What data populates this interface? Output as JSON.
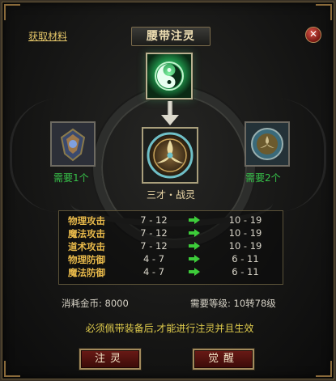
{
  "window": {
    "title": "腰带注灵",
    "get_material_link": "获取材料",
    "close_icon": "close-icon",
    "close_glyph": "✕"
  },
  "slots": {
    "top": {
      "icon": "yin-yang-orb-icon"
    },
    "left": {
      "icon": "crystal-shield-icon",
      "need_text": "需要1个"
    },
    "right": {
      "icon": "triskelion-orb-icon",
      "need_text": "需要2个"
    },
    "center": {
      "icon": "triskelion-belt-icon",
      "name": "三才・战灵"
    }
  },
  "stats": [
    {
      "name": "物理攻击",
      "from": "7 - 12",
      "to": "10 - 19"
    },
    {
      "name": "魔法攻击",
      "from": "7 - 12",
      "to": "10 - 19"
    },
    {
      "name": "道术攻击",
      "from": "7 - 12",
      "to": "10 - 19"
    },
    {
      "name": "物理防御",
      "from": "4 - 7",
      "to": "6 - 11"
    },
    {
      "name": "魔法防御",
      "from": "4 - 7",
      "to": "6 - 11"
    }
  ],
  "cost": {
    "gold_label": "消耗金币:",
    "gold_value": "8000",
    "level_label": "需要等级:",
    "level_value": "10转78级"
  },
  "warning": "必须佩带装备后,才能进行注灵并且生效",
  "buttons": {
    "inject": "注灵",
    "awaken": "觉醒"
  },
  "colors": {
    "stat_name": "#e8b94a",
    "need_text": "#37c24a",
    "warning": "#e0cc4c",
    "button_bg": "#6a1a16"
  }
}
